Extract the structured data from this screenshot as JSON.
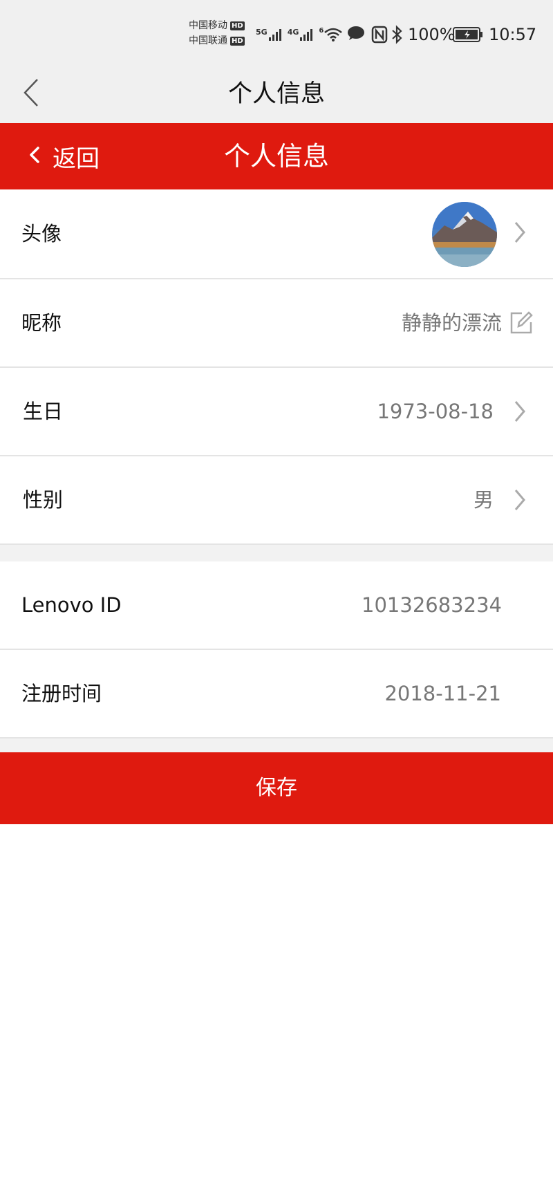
{
  "status_bar": {
    "carrier1": "中国移动",
    "carrier2": "中国联通",
    "hd": "HD",
    "net1": "5G",
    "net2": "4G",
    "wifi_gen": "6",
    "battery_pct": "100%",
    "time": "10:57"
  },
  "nav": {
    "title": "个人信息"
  },
  "header": {
    "back_label": "返回",
    "title": "个人信息"
  },
  "profile": {
    "avatar_label": "头像",
    "nickname_label": "昵称",
    "nickname_value": "静静的漂流",
    "birthday_label": "生日",
    "birthday_value": "1973-08-18",
    "gender_label": "性别",
    "gender_value": "男",
    "lenovo_id_label": "Lenovo ID",
    "lenovo_id_value": "10132683234",
    "register_label": "注册时间",
    "register_value": "2018-11-21"
  },
  "actions": {
    "save_label": "保存"
  },
  "colors": {
    "accent": "#df1a0f",
    "bar_bg": "#f0f0f0",
    "divider": "#e4e4e4",
    "value_text": "#777777"
  }
}
